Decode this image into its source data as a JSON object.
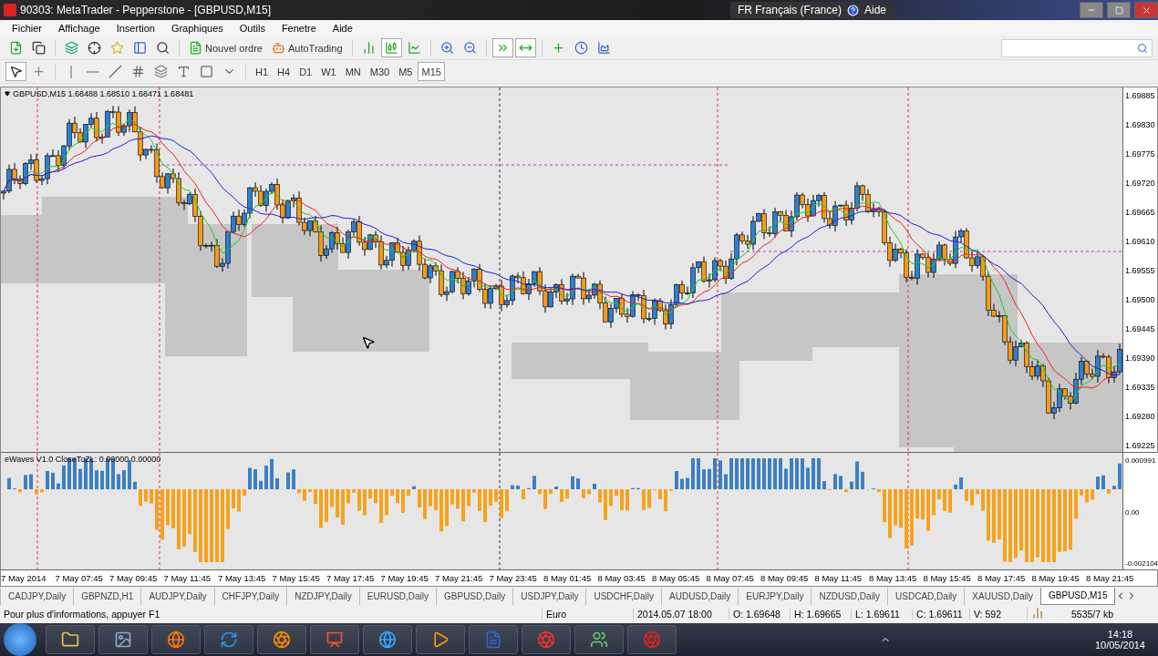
{
  "window": {
    "title": "90303: MetaTrader - Pepperstone - [GBPUSD,M15]"
  },
  "language_bar": {
    "language": "FR Français (France)",
    "help": "Aide"
  },
  "menu": [
    "Fichier",
    "Affichage",
    "Insertion",
    "Graphiques",
    "Outils",
    "Fenetre",
    "Aide"
  ],
  "toolbar": {
    "new_order": "Nouvel ordre",
    "autotrading": "AutoTrading"
  },
  "timeframes": [
    {
      "label": "H1",
      "selected": false
    },
    {
      "label": "H4",
      "selected": false
    },
    {
      "label": "D1",
      "selected": false
    },
    {
      "label": "W1",
      "selected": false
    },
    {
      "label": "MN",
      "selected": false
    },
    {
      "label": "M30",
      "selected": false
    },
    {
      "label": "M5",
      "selected": false
    },
    {
      "label": "M15",
      "selected": true
    }
  ],
  "chart": {
    "header": "GBPUSD,M15  1.68488 1.68510 1.68471 1.68481",
    "price_axis": [
      "1.69885",
      "1.69830",
      "1.69775",
      "1.69720",
      "1.69665",
      "1.69610",
      "1.69555",
      "1.69500",
      "1.69445",
      "1.69390",
      "1.69335",
      "1.69280",
      "1.69225"
    ]
  },
  "indicator": {
    "header": "eWaves V1.0 CloseToZL: 0.00000 0.00000",
    "axis": [
      "0.000991",
      "0.00",
      "-0.002104"
    ]
  },
  "time_axis": [
    "7 May 2014",
    "7 May 07:45",
    "7 May 09:45",
    "7 May 11:45",
    "7 May 13:45",
    "7 May 15:45",
    "7 May 17:45",
    "7 May 19:45",
    "7 May 21:45",
    "7 May 23:45",
    "8 May 01:45",
    "8 May 03:45",
    "8 May 05:45",
    "8 May 07:45",
    "8 May 09:45",
    "8 May 11:45",
    "8 May 13:45",
    "8 May 15:45",
    "8 May 17:45",
    "8 May 19:45",
    "8 May 21:45"
  ],
  "chart_tabs": [
    {
      "label": "CADJPY,Daily",
      "selected": false
    },
    {
      "label": "GBPNZD,H1",
      "selected": false
    },
    {
      "label": "AUDJPY,Daily",
      "selected": false
    },
    {
      "label": "CHFJPY,Daily",
      "selected": false
    },
    {
      "label": "NZDJPY,Daily",
      "selected": false
    },
    {
      "label": "EURUSD,Daily",
      "selected": false
    },
    {
      "label": "GBPUSD,Daily",
      "selected": false
    },
    {
      "label": "USDJPY,Daily",
      "selected": false
    },
    {
      "label": "USDCHF,Daily",
      "selected": false
    },
    {
      "label": "AUDUSD,Daily",
      "selected": false
    },
    {
      "label": "EURJPY,Daily",
      "selected": false
    },
    {
      "label": "NZDUSD,Daily",
      "selected": false
    },
    {
      "label": "USDCAD,Daily",
      "selected": false
    },
    {
      "label": "XAUUSD,Daily",
      "selected": false
    },
    {
      "label": "GBPUSD,M15",
      "selected": true
    }
  ],
  "status_bar": {
    "help": "Pour plus d'informations, appuyer F1",
    "profile": "Euro",
    "time": "2014.05.07 18:00",
    "open": "O: 1.69648",
    "high": "H: 1.69665",
    "low": "L: 1.69611",
    "close": "C: 1.69611",
    "volume": "V: 592",
    "traffic": "5535/7 kb"
  },
  "taskbar": {
    "time": "14:18",
    "date": "10/05/2014"
  }
}
